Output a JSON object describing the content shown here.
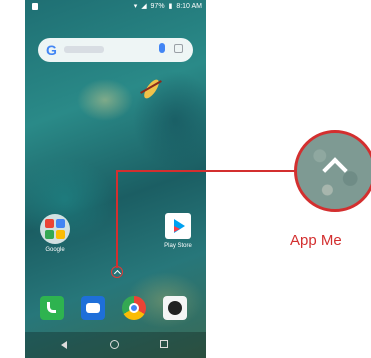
{
  "status_bar": {
    "battery": "97%",
    "time": "8:10 AM"
  },
  "search_widget": {
    "logo": "G",
    "mic_icon": "mic-icon",
    "lens_icon": "lens-icon"
  },
  "home_apps": [
    {
      "label": "Google",
      "icon": "folder-icon"
    },
    {
      "label": "Play Store",
      "icon": "play-store-icon"
    }
  ],
  "dock": [
    "phone-icon",
    "messages-icon",
    "chrome-icon",
    "camera-icon"
  ],
  "callout": {
    "label": "App Me",
    "color": "#d32f2f"
  }
}
